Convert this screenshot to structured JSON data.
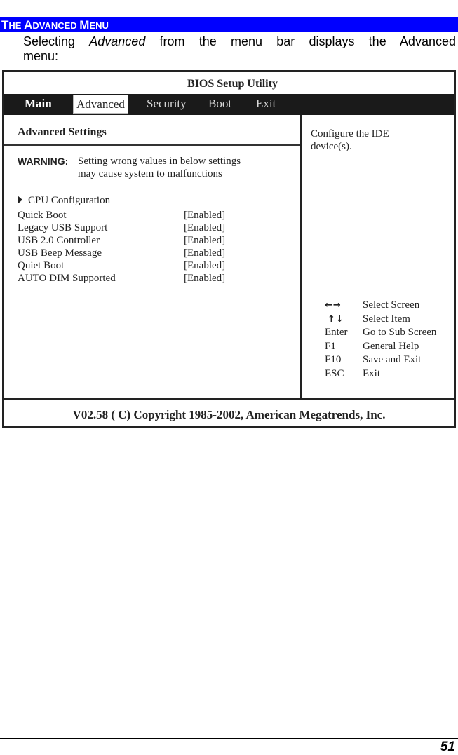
{
  "section": {
    "title_parts": [
      {
        "big": "T",
        "small": "HE "
      },
      {
        "big": "A",
        "small": "DVANCED "
      },
      {
        "big": "M",
        "small": "ENU"
      }
    ],
    "bar_color": "#0000ff"
  },
  "intro": {
    "line1_pre": "Selecting ",
    "line1_em": "Advanced",
    "line1_post": " from the menu bar displays the Advanced",
    "line2": "menu:"
  },
  "bios": {
    "title": "BIOS Setup Utility",
    "menu": [
      {
        "label": "Main",
        "active": false
      },
      {
        "label": "Advanced",
        "active": true
      },
      {
        "label": "Security",
        "active": false
      },
      {
        "label": "Boot",
        "active": false
      },
      {
        "label": "Exit",
        "active": false
      }
    ],
    "left": {
      "heading": "Advanced Settings",
      "warning_label": "WARNING:",
      "warning_line1": "Setting wrong values in below settings",
      "warning_line2": "may cause system to malfunctions",
      "submenu": "CPU Configuration",
      "settings": [
        {
          "label": "Quick Boot",
          "value": "[Enabled]"
        },
        {
          "label": "Legacy USB Support",
          "value": "[Enabled]"
        },
        {
          "label": "USB 2.0 Controller",
          "value": "[Enabled]"
        },
        {
          "label": "USB Beep Message",
          "value": "[Enabled]"
        },
        {
          "label": "Quiet Boot",
          "value": "[Enabled]"
        },
        {
          "label": "AUTO DIM Supported",
          "value": "[Enabled]"
        }
      ]
    },
    "right": {
      "help_line1": "Configure the IDE",
      "help_line2": "device(s).",
      "keys": [
        {
          "key": "←→",
          "icon": "left-right-arrows-icon",
          "desc": "Select Screen"
        },
        {
          "key": "↑↓",
          "icon": "up-down-arrows-icon",
          "desc": "Select Item"
        },
        {
          "key": "Enter",
          "desc": "Go to Sub Screen"
        },
        {
          "key": "F1",
          "desc": "General Help"
        },
        {
          "key": "F10",
          "desc": "Save and Exit"
        },
        {
          "key": "ESC",
          "desc": "Exit"
        }
      ]
    },
    "footer": "V02.58  ( C) Copyright 1985-2002, American Megatrends, Inc."
  },
  "page": {
    "number": "51"
  }
}
